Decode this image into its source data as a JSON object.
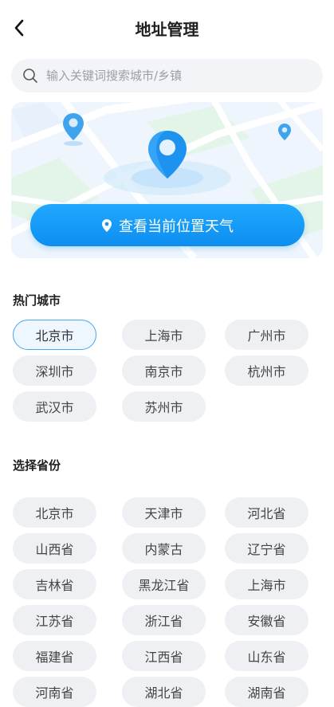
{
  "header": {
    "title": "地址管理"
  },
  "search": {
    "placeholder": "输入关键词搜索城市/乡镇",
    "value": ""
  },
  "location": {
    "button_label": "查看当前位置天气"
  },
  "hot_cities": {
    "title": "热门城市",
    "items": [
      "北京市",
      "上海市",
      "广州市",
      "深圳市",
      "南京市",
      "杭州市",
      "武汉市",
      "苏州市"
    ],
    "selected": "北京市"
  },
  "provinces": {
    "title": "选择省份",
    "items": [
      "北京市",
      "天津市",
      "河北省",
      "山西省",
      "内蒙古",
      "辽宁省",
      "吉林省",
      "黑龙江省",
      "上海市",
      "江苏省",
      "浙江省",
      "安徽省",
      "福建省",
      "江西省",
      "山东省",
      "河南省",
      "湖北省",
      "湖南省"
    ]
  },
  "colors": {
    "accent": "#1a9cf8",
    "chip_bg": "#eef0f3",
    "selected_border": "#4aa7f0"
  },
  "icons": {
    "back": "back-arrow-icon",
    "search": "search-icon",
    "location": "location-pin-icon"
  }
}
